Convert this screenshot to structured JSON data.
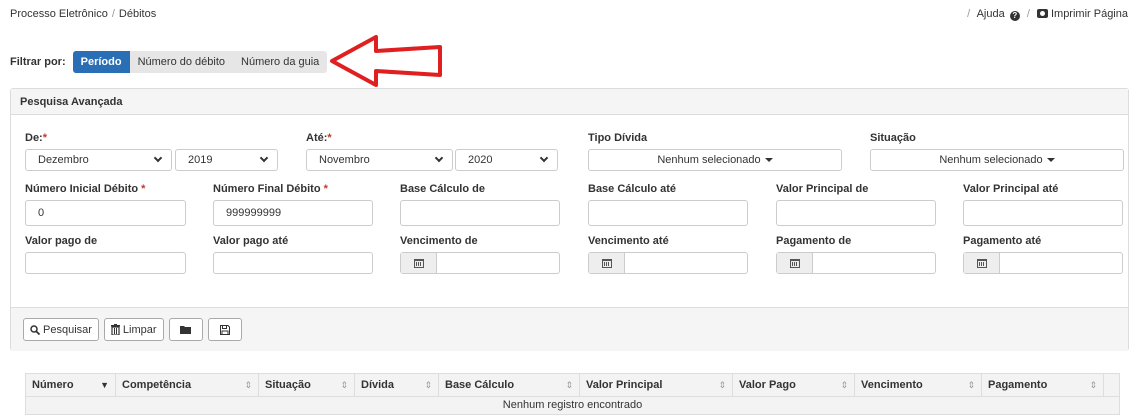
{
  "breadcrumb": {
    "items": [
      "Processo Eletrônico",
      "Débitos"
    ]
  },
  "topright": {
    "help": "Ajuda",
    "print": "Imprimir Página"
  },
  "filter": {
    "label": "Filtrar por:",
    "options": [
      "Período",
      "Número do débito",
      "Número da guia"
    ],
    "selected": "Período"
  },
  "panel": {
    "title": "Pesquisa Avançada",
    "de": {
      "label": "De:",
      "required": "*",
      "month": "Dezembro",
      "year": "2019"
    },
    "ate": {
      "label": "Até:",
      "required": "*",
      "month": "Novembro",
      "year": "2020"
    },
    "tipo_divida": {
      "label": "Tipo Dívida",
      "value": "Nenhum selecionado"
    },
    "situacao": {
      "label": "Situação",
      "value": "Nenhum selecionado"
    },
    "num_inicial": {
      "label": "Número Inicial Débito",
      "required": "*",
      "value": "0"
    },
    "num_final": {
      "label": "Número Final Débito",
      "required": "*",
      "value": "999999999"
    },
    "base_de": {
      "label": "Base Cálculo de",
      "value": ""
    },
    "base_ate": {
      "label": "Base Cálculo até",
      "value": ""
    },
    "vp_de": {
      "label": "Valor Principal de",
      "value": ""
    },
    "vp_ate": {
      "label": "Valor Principal até",
      "value": ""
    },
    "pago_de": {
      "label": "Valor pago de",
      "value": ""
    },
    "pago_ate": {
      "label": "Valor pago até",
      "value": ""
    },
    "venc_de": {
      "label": "Vencimento de",
      "value": ""
    },
    "venc_ate": {
      "label": "Vencimento até",
      "value": ""
    },
    "pag_de": {
      "label": "Pagamento de",
      "value": ""
    },
    "pag_ate": {
      "label": "Pagamento até",
      "value": ""
    },
    "buttons": {
      "search": "Pesquisar",
      "clear": "Limpar"
    }
  },
  "table": {
    "columns": [
      "Número",
      "Competência",
      "Situação",
      "Dívida",
      "Base Cálculo",
      "Valor Principal",
      "Valor Pago",
      "Vencimento",
      "Pagamento"
    ],
    "empty": "Nenhum registro encontrado"
  },
  "colors": {
    "accent": "#2a6eb5",
    "arrow": "#e02020"
  }
}
